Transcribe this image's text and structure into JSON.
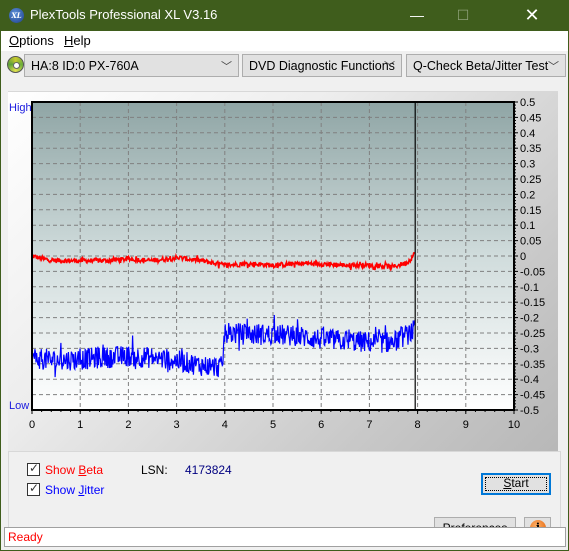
{
  "window": {
    "title": "PlexTools Professional XL V3.16",
    "icon_text": "XL",
    "minimize_glyph": "—",
    "maximize_glyph": "☐",
    "close_glyph": "✕"
  },
  "menu": {
    "items": [
      {
        "label": "Options",
        "mnemonic": "O",
        "rest": "ptions"
      },
      {
        "label": "Help",
        "mnemonic": "H",
        "rest": "elp"
      }
    ]
  },
  "toolbar": {
    "drive_select": "HA:8 ID:0  PX-760A",
    "function_select": "DVD Diagnostic Functions",
    "test_select": "Q-Check Beta/Jitter Test",
    "chevron": "﹀"
  },
  "chart_labels": {
    "high": "High",
    "low": "Low"
  },
  "chart_data": {
    "type": "line",
    "title": "",
    "xlabel": "",
    "ylabel": "",
    "xlim": [
      0,
      10
    ],
    "ylim": [
      -0.5,
      0.5
    ],
    "x_ticks": [
      "0",
      "1",
      "2",
      "3",
      "4",
      "5",
      "6",
      "7",
      "8",
      "9",
      "10"
    ],
    "y_ticks": [
      "0.5",
      "0.45",
      "0.4",
      "0.35",
      "0.3",
      "0.25",
      "0.2",
      "0.15",
      "0.1",
      "0.05",
      "0",
      "-0.05",
      "-0.1",
      "-0.15",
      "-0.2",
      "-0.25",
      "-0.3",
      "-0.35",
      "-0.4",
      "-0.45",
      "-0.5"
    ],
    "grid": true,
    "marker_x": 7.95,
    "colors": {
      "beta": "#ff0000",
      "jitter": "#0000ff"
    },
    "series": [
      {
        "name": "Beta",
        "x": [
          0,
          0.25,
          0.5,
          1,
          1.5,
          2,
          2.5,
          3,
          3.5,
          4,
          4.5,
          5,
          5.5,
          6,
          6.5,
          7,
          7.5,
          7.8,
          7.95
        ],
        "values": [
          0.0,
          -0.01,
          -0.015,
          -0.015,
          -0.015,
          -0.01,
          -0.015,
          -0.005,
          -0.015,
          -0.03,
          -0.025,
          -0.03,
          -0.025,
          -0.025,
          -0.03,
          -0.03,
          -0.035,
          -0.02,
          0.01
        ],
        "noise": 0.008
      },
      {
        "name": "Jitter",
        "x": [
          0,
          0.5,
          1,
          1.5,
          2,
          2.5,
          3,
          3.5,
          3.8,
          3.95,
          4.0,
          4.1,
          4.5,
          5,
          5.5,
          6,
          6.5,
          7,
          7.5,
          7.95
        ],
        "values": [
          -0.33,
          -0.34,
          -0.335,
          -0.33,
          -0.325,
          -0.33,
          -0.34,
          -0.355,
          -0.36,
          -0.36,
          -0.24,
          -0.25,
          -0.255,
          -0.255,
          -0.26,
          -0.27,
          -0.275,
          -0.28,
          -0.28,
          -0.24
        ],
        "noise": 0.035
      }
    ]
  },
  "options": {
    "show_beta": {
      "label_pre": "Show ",
      "mnemonic": "B",
      "label_post": "eta",
      "checked": true,
      "color": "#ff0000"
    },
    "show_jitter": {
      "label_pre": "Show ",
      "mnemonic": "J",
      "label_post": "itter",
      "checked": true,
      "color": "#0000ff"
    }
  },
  "lsn": {
    "label": "LSN:",
    "value": "4173824"
  },
  "buttons": {
    "start_mnemonic": "S",
    "start_rest": "tart",
    "prefs_mnemonic": "P",
    "prefs_rest": "references",
    "info_glyph": "i"
  },
  "status": {
    "text": "Ready"
  }
}
